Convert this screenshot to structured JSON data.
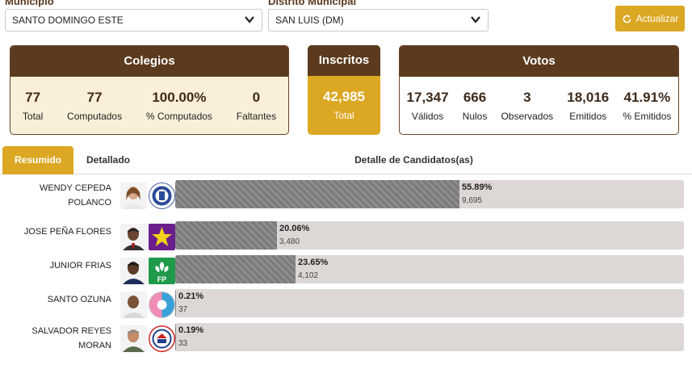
{
  "filters": {
    "municipio_label": "Municipio",
    "municipio_value": "SANTO DOMINGO ESTE",
    "distrito_label": "Distrito Municipal",
    "distrito_value": "SAN LUIS (DM)",
    "refresh_label": "Actualizar"
  },
  "colegios": {
    "title": "Colegios",
    "stats": [
      {
        "value": "77",
        "label": "Total"
      },
      {
        "value": "77",
        "label": "Computados"
      },
      {
        "value": "100.00%",
        "label": "% Computados"
      },
      {
        "value": "0",
        "label": "Faltantes"
      }
    ]
  },
  "inscritos": {
    "title": "Inscritos",
    "value": "42,985",
    "label": "Total"
  },
  "votos": {
    "title": "Votos",
    "stats": [
      {
        "value": "17,347",
        "label": "Válidos"
      },
      {
        "value": "666",
        "label": "Nulos"
      },
      {
        "value": "3",
        "label": "Observados"
      },
      {
        "value": "18,016",
        "label": "Emitidos"
      },
      {
        "value": "41.91%",
        "label": "% Emitidos"
      }
    ]
  },
  "tabs": {
    "resumen": "Resumido",
    "detallado": "Detallado",
    "section_title": "Detalle de Candidatos(as)"
  },
  "candidates": [
    {
      "name_line1": "WENDY CEPEDA",
      "name_line2": "POLANCO",
      "pct_label": "55.89%",
      "pct": 55.89,
      "votes": "9,695"
    },
    {
      "name_line1": "JOSE PEÑA FLORES",
      "name_line2": "",
      "pct_label": "20.06%",
      "pct": 20.06,
      "votes": "3,480"
    },
    {
      "name_line1": "JUNIOR FRIAS",
      "name_line2": "",
      "pct_label": "23.65%",
      "pct": 23.65,
      "votes": "4,102"
    },
    {
      "name_line1": "SANTO OZUNA",
      "name_line2": "",
      "pct_label": "0.21%",
      "pct": 0.21,
      "votes": "37"
    },
    {
      "name_line1": "SALVADOR REYES",
      "name_line2": "MORAN",
      "pct_label": "0.19%",
      "pct": 0.19,
      "votes": "33"
    }
  ],
  "party_logos": {
    "fp_text": "FP"
  },
  "colors": {
    "brown": "#5b3a1d",
    "gold": "#dca722",
    "cream": "#faf0d9",
    "track": "#ddd7d5"
  }
}
